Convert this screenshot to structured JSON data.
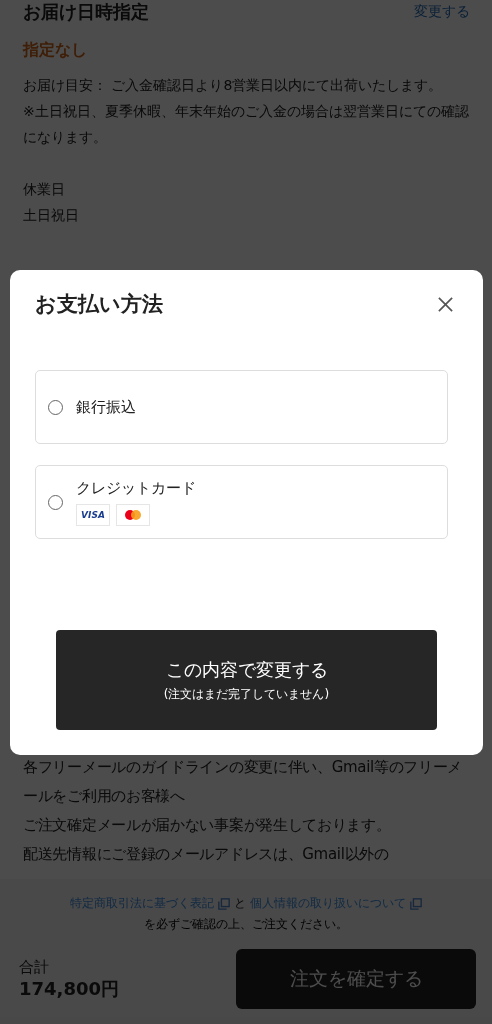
{
  "delivery": {
    "title": "お届け日時指定",
    "change_link": "変更する",
    "value": "指定なし",
    "notes": [
      "お届け目安： ご入金確認日より8営業日以内にて出荷いたします。",
      "※土日祝日、夏季休暇、年末年始のご入金の場合は翌営業日にての確認になります。"
    ],
    "holiday_label": "休業日",
    "holiday_days": "土日祝日"
  },
  "mail_notice": [
    "各フリーメールのガイドラインの変更に伴い、Gmail等のフリーメールをご利用のお客様へ",
    "ご注文確定メールが届かない事案が発生しております。",
    "配送先情報にご登録のメールアドレスは、Gmail以外の"
  ],
  "footer": {
    "links": [
      "特定商取引法に基づく表記",
      "個人情報の取り扱いについて"
    ],
    "joiner": "と",
    "confirm_note": "を必ずご確認の上、ご注文ください。",
    "total_label": "合計",
    "total": "174,800円",
    "order_button": "注文を確定する"
  },
  "modal": {
    "title": "お支払い方法",
    "options": [
      {
        "kind": "plain",
        "label": "銀行振込",
        "selected": false
      },
      {
        "kind": "cards",
        "label": "クレジットカード",
        "selected": false,
        "brands": [
          {
            "kind": "visa",
            "label": "VISA"
          },
          {
            "kind": "mastercard"
          }
        ]
      }
    ],
    "submit": {
      "label": "この内容で変更する",
      "sub": "(注文はまだ完了していません)"
    }
  }
}
